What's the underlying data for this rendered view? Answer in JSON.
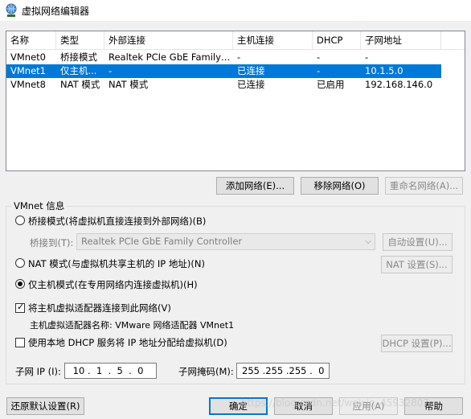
{
  "window": {
    "title": "虚拟网络编辑器"
  },
  "table": {
    "columns": [
      "名称",
      "类型",
      "外部连接",
      "主机连接",
      "DHCP",
      "子网地址"
    ],
    "rows": [
      [
        "VMnet0",
        "桥接模式",
        "Realtek PCIe GbE Family Co...",
        "-",
        "-",
        "-"
      ],
      [
        "VMnet1",
        "仅主机...",
        "-",
        "已连接",
        "-",
        "10.1.5.0"
      ],
      [
        "VMnet8",
        "NAT 模式",
        "NAT 模式",
        "已连接",
        "已启用",
        "192.168.146.0"
      ]
    ],
    "selected_row": 1
  },
  "buttons": {
    "add_network": "添加网络(E)...",
    "remove_network": "移除网络(O)",
    "rename_network": "重命名网络(A)...",
    "auto_settings": "自动设置(U)...",
    "nat_settings": "NAT 设置(S)...",
    "dhcp_settings": "DHCP 设置(P)...",
    "restore_defaults": "还原默认设置(R)",
    "ok": "确定",
    "cancel": "取消",
    "apply": "应用(A)",
    "help": "帮助"
  },
  "vmnet_info": {
    "group_title": "VMnet 信息",
    "bridged_label": "桥接模式(将虚拟机直接连接到外部网络)(B)",
    "bridged_to_label": "桥接到(T):",
    "bridged_to_value": "Realtek PCIe GbE Family Controller",
    "nat_label": "NAT 模式(与虚拟机共享主机的 IP 地址)(N)",
    "hostonly_label": "仅主机模式(在专用网络内连接虚拟机)(H)",
    "selected_mode": "hostonly",
    "connect_adapter_label": "将主机虚拟适配器连接到此网络(V)",
    "connect_adapter_checked": true,
    "adapter_name_label": "主机虚拟适配器名称: VMware 网络适配器 VMnet1",
    "dhcp_label": "使用本地 DHCP 服务将 IP 地址分配给虚拟机(D)",
    "dhcp_checked": false,
    "subnet_ip_label": "子网 IP (I):",
    "subnet_ip_value": " 10 .  1  .  5  .  0",
    "subnet_mask_label": "子网掩码(M):",
    "subnet_mask_value": "255 .255 .255 .  0"
  },
  "watermark": "https://blog.csdn.net/weixin_45932807",
  "colors": {
    "selection": "#0078d7",
    "background": "#f0f0f0"
  }
}
